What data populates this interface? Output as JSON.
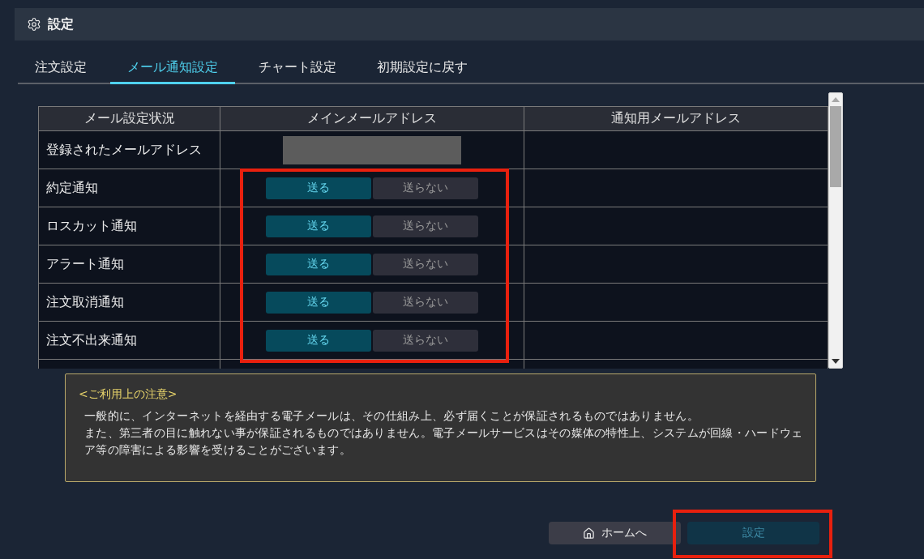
{
  "header": {
    "title": "設定"
  },
  "tabs": [
    {
      "label": "注文設定",
      "selected": false
    },
    {
      "label": "メール通知設定",
      "selected": true
    },
    {
      "label": "チャート設定",
      "selected": false
    },
    {
      "label": "初期設定に戻す",
      "selected": false
    }
  ],
  "table": {
    "columns": [
      "メール設定状況",
      "メインメールアドレス",
      "通知用メールアドレス"
    ],
    "toggles_highlighted": true,
    "rows": [
      {
        "kind": "address",
        "label": "登録されたメールアドレス"
      },
      {
        "kind": "toggle",
        "label": "約定通知",
        "options": [
          {
            "label": "送る",
            "selected": true
          },
          {
            "label": "送らない",
            "selected": false
          }
        ]
      },
      {
        "kind": "toggle",
        "label": "ロスカット通知",
        "options": [
          {
            "label": "送る",
            "selected": true
          },
          {
            "label": "送らない",
            "selected": false
          }
        ]
      },
      {
        "kind": "toggle",
        "label": "アラート通知",
        "options": [
          {
            "label": "送る",
            "selected": true
          },
          {
            "label": "送らない",
            "selected": false
          }
        ]
      },
      {
        "kind": "toggle",
        "label": "注文取消通知",
        "options": [
          {
            "label": "送る",
            "selected": true
          },
          {
            "label": "送らない",
            "selected": false
          }
        ]
      },
      {
        "kind": "toggle",
        "label": "注文不出来通知",
        "options": [
          {
            "label": "送る",
            "selected": true
          },
          {
            "label": "送らない",
            "selected": false
          }
        ]
      }
    ]
  },
  "notice": {
    "title": "<ご利用上の注意>",
    "paragraphs": [
      "一般的に、インターネットを経由する電子メールは、その仕組み上、必ず届くことが保証されるものではありません。",
      "また、第三者の目に触れない事が保証されるものではありません。電子メールサービスはその媒体の特性上、システムが回線・ハードウェア等の障害による影響を受けることがございます。"
    ]
  },
  "actions": [
    {
      "kind": "home",
      "label": "ホームへ",
      "highlighted": false
    },
    {
      "kind": "submit",
      "label": "設定",
      "highlighted": true
    }
  ]
}
